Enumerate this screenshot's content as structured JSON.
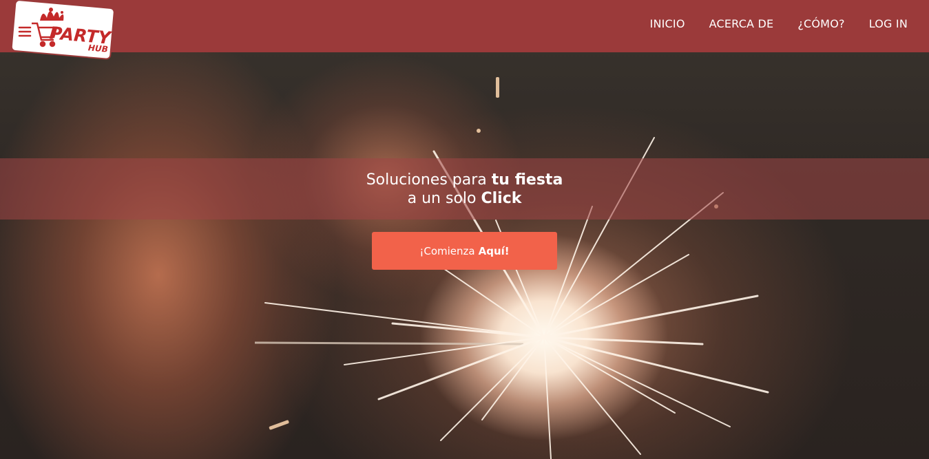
{
  "brand": {
    "logo_word_top": "PARTY",
    "logo_word_bottom": "HUB",
    "menu_icon": "hamburger-icon",
    "cart_icon": "shopping-cart-icon",
    "colors": {
      "header": "#9b3a3a",
      "logo_red": "#c42a2a",
      "cta": "#f2624a"
    }
  },
  "nav": {
    "items": [
      {
        "label": "INICIO"
      },
      {
        "label": "ACERCA DE"
      },
      {
        "label": "¿CÓMO?"
      },
      {
        "label": "LOG IN"
      }
    ]
  },
  "hero": {
    "line1_regular": "Soluciones para ",
    "line1_bold": "tu fiesta",
    "line2_regular": "a un solo ",
    "line2_bold": "Click",
    "cta_regular": "¡Comienza",
    "cta_bold": "Aquí!"
  }
}
